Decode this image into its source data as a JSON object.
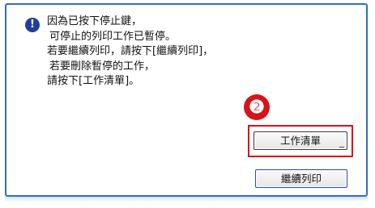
{
  "dialog": {
    "icon": "info-icon",
    "message_lines": [
      "因為已按下停止鍵，",
      "可停止的列印工作已暫停。",
      "若要繼續列印，請按下[繼續列印]，",
      "若要刪除暫停的工作，",
      "請按下[工作清單]。"
    ]
  },
  "annotation": {
    "step_number": "❷",
    "highlight_color": "#d8131b"
  },
  "buttons": {
    "job_list_label": "工作清單",
    "continue_print_label": "繼續列印"
  },
  "colors": {
    "frame_border": "#2e6fba",
    "info_icon": "#1e3f9a"
  }
}
